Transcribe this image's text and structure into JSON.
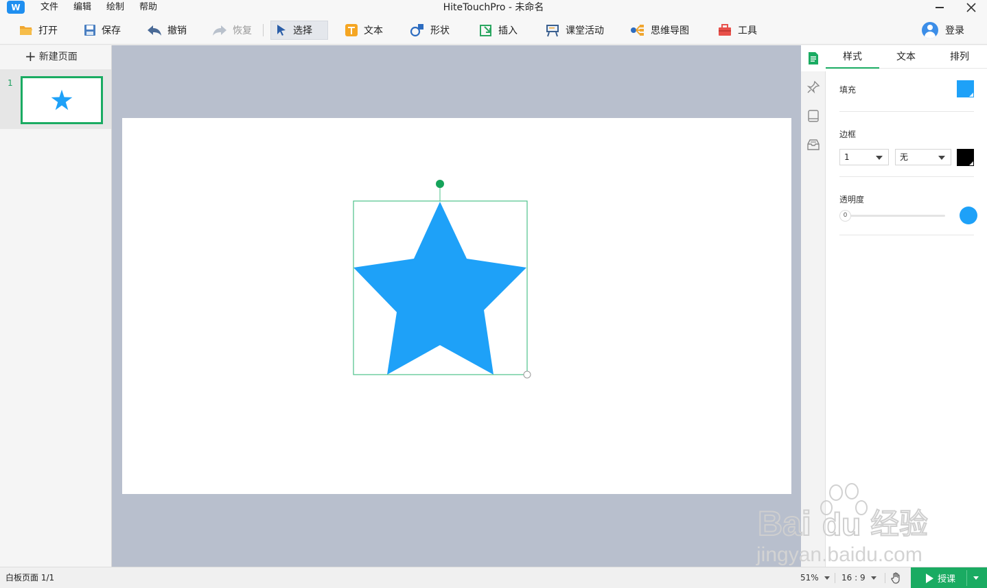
{
  "app": {
    "title": "HiteTouchPro - 未命名",
    "logo_text": "W"
  },
  "menu": [
    "文件",
    "编辑",
    "绘制",
    "帮助"
  ],
  "toolbar": {
    "open": "打开",
    "save": "保存",
    "undo": "撤销",
    "redo": "恢复",
    "select": "选择",
    "text": "文本",
    "shape": "形状",
    "insert": "插入",
    "classroom": "课堂活动",
    "mindmap": "思维导图",
    "tools": "工具",
    "login": "登录"
  },
  "pages": {
    "new_page": "新建页面",
    "items": [
      {
        "number": "1"
      }
    ]
  },
  "canvas": {
    "shape": "star",
    "fill_color": "#1ea1f8",
    "selection_color": "#4cc08a",
    "rotate_handle_color": "#15a35a"
  },
  "props": {
    "tabs": [
      "样式",
      "文本",
      "排列"
    ],
    "active_tab": "样式",
    "fill_label": "填充",
    "fill_color": "#1ea1f8",
    "border_label": "边框",
    "border_width": "1",
    "border_style": "无",
    "border_color": "#000000",
    "opacity_label": "透明度",
    "opacity_min": "0",
    "opacity_value": 1.0
  },
  "side_icons": [
    "document-icon",
    "pin-icon",
    "book-icon",
    "tray-icon"
  ],
  "status": {
    "page_info": "白板页面 1/1",
    "zoom": "51%",
    "ratio": "16 : 9",
    "teach": "授课"
  },
  "watermark": {
    "brand": "Bai",
    "brand_suffix": "du",
    "product": "经验",
    "url": "jingyan.baidu.com"
  }
}
